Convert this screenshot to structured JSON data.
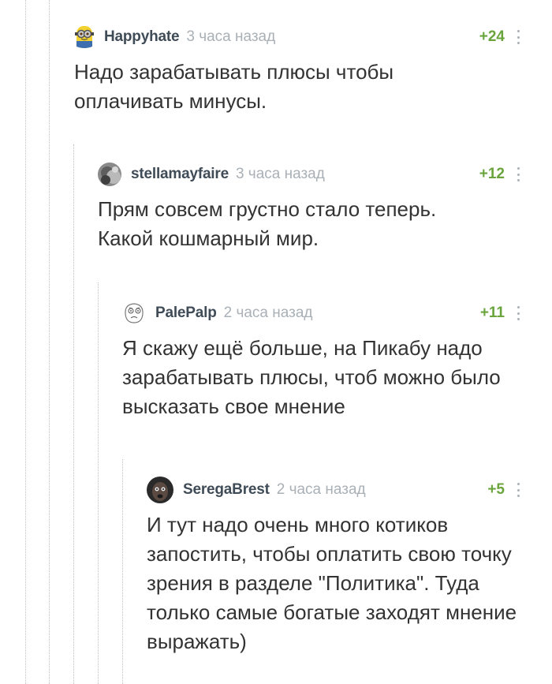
{
  "comments": [
    {
      "username": "Happyhate",
      "time": "3 часа назад",
      "rating": "+24",
      "avatar_icon": "minion-avatar-icon",
      "text": "Надо зарабатывать плюсы чтобы оплачивать минусы."
    },
    {
      "username": "stellamayfaire",
      "time": "3 часа назад",
      "rating": "+12",
      "avatar_icon": "photo-avatar-icon",
      "text": "Прям совсем грустно стало теперь. Какой кошмарный мир."
    },
    {
      "username": "PalePalp",
      "time": "2 часа назад",
      "rating": "+11",
      "avatar_icon": "meme-face-avatar-icon",
      "text": "Я скажу ещё больше, на Пикабу надо зарабатывать плюсы, чтоб можно было высказать свое мнение"
    },
    {
      "username": "SeregaBrest",
      "time": "2 часа назад",
      "rating": "+5",
      "avatar_icon": "dark-photo-avatar-icon",
      "text": "И тут надо очень много котиков запостить, чтобы оплатить свою точку зрения в разделе \"Политика\". Туда только самые богатые заходят мнение выражать)"
    }
  ],
  "colors": {
    "rating": "#6aa43c",
    "username": "#3f4b56",
    "time": "#a9b0b6",
    "text": "#333333"
  }
}
